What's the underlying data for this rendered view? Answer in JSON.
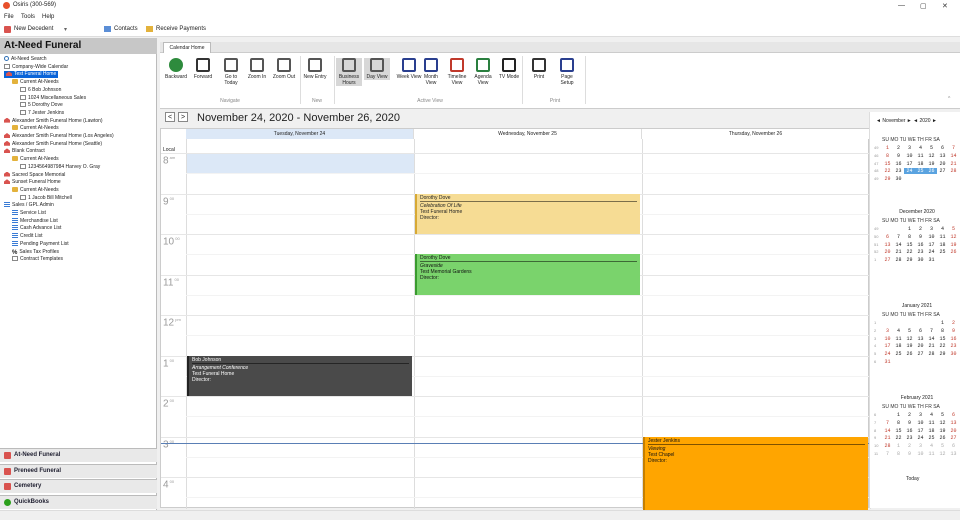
{
  "window": {
    "title": "Osiris (300-569)",
    "minimize": "—",
    "maximize": "▢",
    "close": "✕"
  },
  "menu": {
    "items": [
      "File",
      "Tools",
      "Help"
    ]
  },
  "toolstrip": {
    "new_decedent": "New Decedent",
    "contacts": "Contacts",
    "receive_payments": "Receive Payments"
  },
  "sidebar": {
    "header": "At-Need Funeral",
    "tree": [
      {
        "label": "At-Need Search",
        "icon": "search",
        "indent": 1
      },
      {
        "label": "Company-Wide Calendar",
        "icon": "doc",
        "indent": 1
      },
      {
        "label": "Test Funeral Home",
        "icon": "home",
        "indent": 1,
        "selected": true
      },
      {
        "label": "Current At-Needs",
        "icon": "folder",
        "indent": 2
      },
      {
        "label": "6 Bob Johnson",
        "icon": "doc",
        "indent": 3
      },
      {
        "label": "1024 Miscellaneous Sales",
        "icon": "doc",
        "indent": 3
      },
      {
        "label": "5 Dorothy Dove",
        "icon": "doc",
        "indent": 3
      },
      {
        "label": "7 Jester Jenkins",
        "icon": "doc",
        "indent": 3
      },
      {
        "label": "Alexander Smith Funeral Home (Lawton)",
        "icon": "home",
        "indent": 1
      },
      {
        "label": "Current At-Needs",
        "icon": "folder",
        "indent": 2
      },
      {
        "label": "Alexander Smith Funeral Home (Los Angeles)",
        "icon": "home",
        "indent": 1
      },
      {
        "label": "Alexander Smith Funeral Home (Seattle)",
        "icon": "home",
        "indent": 1
      },
      {
        "label": "Blank Contract",
        "icon": "home",
        "indent": 1
      },
      {
        "label": "Current At-Needs",
        "icon": "folder",
        "indent": 2
      },
      {
        "label": "1234564987984 Harvey O. Gray",
        "icon": "doc",
        "indent": 3
      },
      {
        "label": "Sacred Space Memorial",
        "icon": "home",
        "indent": 1
      },
      {
        "label": "Sunset Funeral Home",
        "icon": "home",
        "indent": 1
      },
      {
        "label": "Current At-Needs",
        "icon": "folder",
        "indent": 2
      },
      {
        "label": "1 Jacob Bill Mitchell",
        "icon": "doc",
        "indent": 3
      },
      {
        "label": "Sales / GPL Admin",
        "icon": "list",
        "indent": 1
      },
      {
        "label": "Service List",
        "icon": "list",
        "indent": 2
      },
      {
        "label": "Merchandise List",
        "icon": "list",
        "indent": 2
      },
      {
        "label": "Cash Advance List",
        "icon": "list",
        "indent": 2
      },
      {
        "label": "Credit List",
        "icon": "list",
        "indent": 2
      },
      {
        "label": "Pending Payment List",
        "icon": "list",
        "indent": 2
      },
      {
        "label": "Sales Tax Profiles",
        "icon": "pct",
        "indent": 2
      },
      {
        "label": "Contract Templates",
        "icon": "doc",
        "indent": 2
      }
    ],
    "modules": [
      {
        "label": "At-Need Funeral",
        "color": "#d9534f"
      },
      {
        "label": "Preneed Funeral",
        "color": "#d9534f"
      },
      {
        "label": "Cemetery",
        "color": "#d9534f"
      },
      {
        "label": "QuickBooks",
        "color": "#2ca01c"
      }
    ]
  },
  "ribbon": {
    "tab": "Calendar Home",
    "buttons": [
      {
        "label": "Backward",
        "icon": "back-arrow-icon",
        "color": "#2e8b3d"
      },
      {
        "label": "Forward",
        "icon": "forward-car-icon",
        "color": "#333"
      },
      {
        "label": "Go to Today",
        "icon": "calendar-today-icon",
        "color": "#555"
      },
      {
        "label": "Zoom In",
        "icon": "zoom-in-icon",
        "color": "#555"
      },
      {
        "label": "Zoom Out",
        "icon": "zoom-out-icon",
        "color": "#555"
      },
      {
        "label": "New Entry",
        "icon": "new-entry-icon",
        "color": "#555"
      },
      {
        "label": "Business Hours",
        "icon": "business-hours-icon",
        "color": "#555"
      },
      {
        "label": "Day View",
        "icon": "day-view-icon",
        "color": "#555"
      },
      {
        "label": "Week View",
        "icon": "week-view-icon",
        "color": "#2a3f8f"
      },
      {
        "label": "Month View",
        "icon": "month-view-icon",
        "color": "#2a3f8f"
      },
      {
        "label": "Timeline View",
        "icon": "timeline-pin-icon",
        "color": "#c0392b"
      },
      {
        "label": "Agenda View",
        "icon": "agenda-view-icon",
        "color": "#2a7f3f"
      },
      {
        "label": "TV Mode",
        "icon": "tv-mode-icon",
        "color": "#222"
      },
      {
        "label": "Print",
        "icon": "print-icon",
        "color": "#333"
      },
      {
        "label": "Page Setup",
        "icon": "page-setup-icon",
        "color": "#2a3f8f"
      }
    ],
    "groups": {
      "navigate": "Navigate",
      "new": "New",
      "active_view": "Active View",
      "print": "Print"
    }
  },
  "calendar": {
    "range_title": "November 24, 2020 - November 26, 2020",
    "prev": "<",
    "next": ">",
    "local_label": "Local",
    "days": [
      "Tuesday, November 24",
      "Wednesday, November 25",
      "Thursday, November 26"
    ],
    "hours": [
      {
        "h": "8",
        "suffix": "am"
      },
      {
        "h": "9",
        "suffix": "00"
      },
      {
        "h": "10",
        "suffix": "00"
      },
      {
        "h": "11",
        "suffix": "00"
      },
      {
        "h": "12",
        "suffix": "pm"
      },
      {
        "h": "1",
        "suffix": "00"
      },
      {
        "h": "2",
        "suffix": "00"
      },
      {
        "h": "3",
        "suffix": "00"
      },
      {
        "h": "4",
        "suffix": "00"
      }
    ],
    "appointments": [
      {
        "name": "Dorothy Dove",
        "event": "Celebration Of Life",
        "location": "Test Funeral Home",
        "director": "Director:",
        "day": 1,
        "start": 9.0,
        "end": 10.0,
        "bg": "#f6dc94",
        "border": "#d7a934",
        "fg": "#222"
      },
      {
        "name": "Dorothy Dove",
        "event": "Graveside",
        "location": "Test Memorial Gardens",
        "director": "Director:",
        "day": 1,
        "start": 10.5,
        "end": 11.5,
        "bg": "#7ad36c",
        "border": "#3a9b2f",
        "fg": "#111"
      },
      {
        "name": "Bob Johnson",
        "event": "Arrangement Conference",
        "location": "Test Funeral Home",
        "director": "Director:",
        "day": 0,
        "start": 13.0,
        "end": 14.0,
        "bg": "#4a4a4a",
        "border": "#222",
        "fg": "#fff"
      },
      {
        "name": "Jester Jenkins",
        "event": "Viewing",
        "location": "Test Chapel",
        "director": "Director:",
        "day": 2,
        "start": 15.0,
        "end": 17.0,
        "bg": "#ffa500",
        "border": "#c67f00",
        "fg": "#111"
      }
    ]
  },
  "minical": {
    "nav": "◄  November  ►   ◄  2020  ►",
    "dow": "SU MO TU WE TH FR SA",
    "today": "Today",
    "months": [
      {
        "title": "November",
        "year": "2020",
        "weeks": [
          "49",
          "46",
          "47",
          "48",
          "49"
        ],
        "rows": [
          [
            "1",
            "2",
            "3",
            "4",
            "5",
            "6",
            "7"
          ],
          [
            "8",
            "9",
            "10",
            "11",
            "12",
            "13",
            "14"
          ],
          [
            "15",
            "16",
            "17",
            "18",
            "19",
            "20",
            "21"
          ],
          [
            "22",
            "23",
            "24",
            "25",
            "26",
            "27",
            "28"
          ],
          [
            "29",
            "30",
            "",
            "",
            "",
            "",
            ""
          ]
        ],
        "sel": [
          "24",
          "25",
          "26"
        ]
      },
      {
        "title": "December",
        "year": "2020",
        "weeks": [
          "49",
          "50",
          "51",
          "52",
          "1"
        ],
        "rows": [
          [
            "",
            "",
            "1",
            "2",
            "3",
            "4",
            "5"
          ],
          [
            "6",
            "7",
            "8",
            "9",
            "10",
            "11",
            "12"
          ],
          [
            "13",
            "14",
            "15",
            "16",
            "17",
            "18",
            "19"
          ],
          [
            "20",
            "21",
            "22",
            "23",
            "24",
            "25",
            "26"
          ],
          [
            "27",
            "28",
            "29",
            "30",
            "31",
            "",
            ""
          ]
        ],
        "sel": []
      },
      {
        "title": "January",
        "year": "2021",
        "weeks": [
          "1",
          "2",
          "3",
          "4",
          "5",
          "6"
        ],
        "rows": [
          [
            "",
            "",
            "",
            "",
            "",
            "1",
            "2"
          ],
          [
            "3",
            "4",
            "5",
            "6",
            "7",
            "8",
            "9"
          ],
          [
            "10",
            "11",
            "12",
            "13",
            "14",
            "15",
            "16"
          ],
          [
            "17",
            "18",
            "19",
            "20",
            "21",
            "22",
            "23"
          ],
          [
            "24",
            "25",
            "26",
            "27",
            "28",
            "29",
            "30"
          ],
          [
            "31",
            "",
            "",
            "",
            "",
            "",
            ""
          ]
        ],
        "sel": []
      },
      {
        "title": "February",
        "year": "2021",
        "weeks": [
          "6",
          "7",
          "8",
          "9",
          "10",
          "11"
        ],
        "rows": [
          [
            "",
            "1",
            "2",
            "3",
            "4",
            "5",
            "6"
          ],
          [
            "7",
            "8",
            "9",
            "10",
            "11",
            "12",
            "13"
          ],
          [
            "14",
            "15",
            "16",
            "17",
            "18",
            "19",
            "20"
          ],
          [
            "21",
            "22",
            "23",
            "24",
            "25",
            "26",
            "27"
          ],
          [
            "28",
            "1",
            "2",
            "3",
            "4",
            "5",
            "6"
          ],
          [
            "7",
            "8",
            "9",
            "10",
            "11",
            "12",
            "13"
          ]
        ],
        "sel": [],
        "grey_after": 28
      }
    ]
  }
}
